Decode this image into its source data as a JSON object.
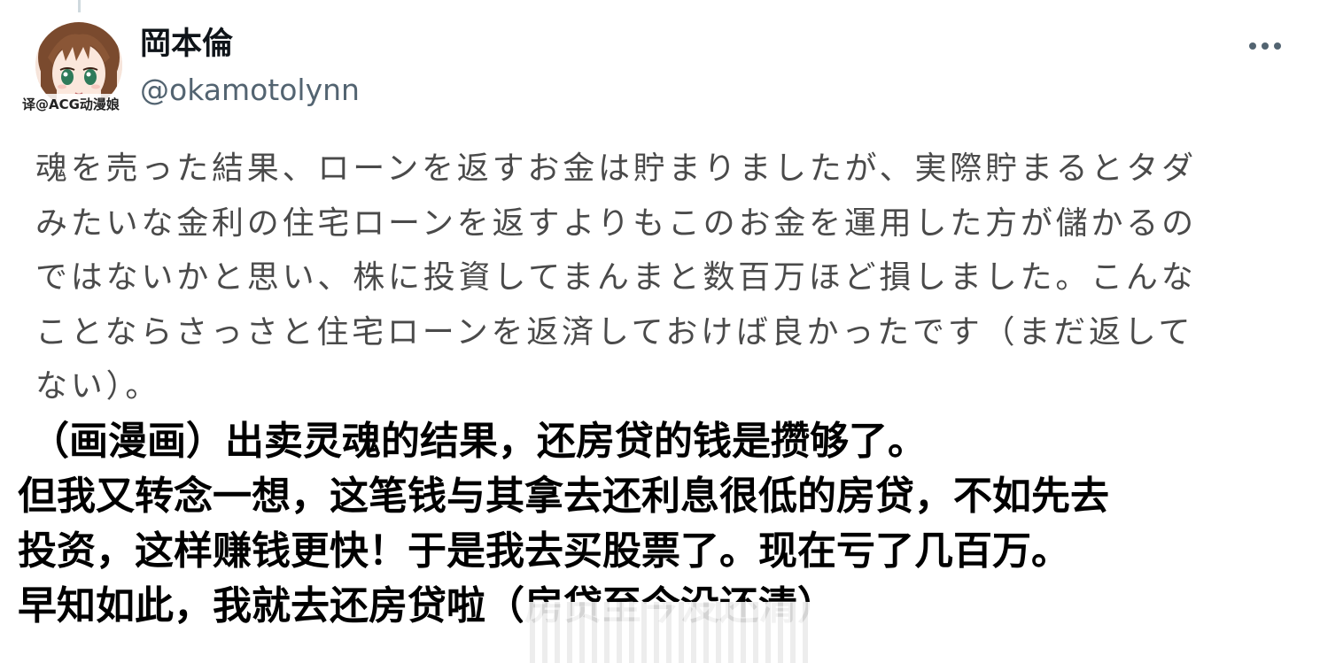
{
  "author": {
    "display_name": "岡本倫",
    "handle": "@okamotolynn",
    "avatar_watermark": "译@ACG动漫娘"
  },
  "tweet": {
    "lines": [
      "魂を売った結果、ローンを返すお金は貯まりましたが、実際貯まるとタダ",
      "みたいな金利の住宅ローンを返すよりもこのお金を運用した方が儲かるの",
      "ではないかと思い、株に投資してまんまと数百万ほど損しました。こんな",
      "ことならさっさと住宅ローンを返済しておけば良かったです（まだ返して",
      "ない）。"
    ]
  },
  "translation": {
    "lines": [
      "（画漫画）出卖灵魂的结果，还房贷的钱是攒够了。",
      "但我又转念一想，这笔钱与其拿去还利息很低的房贷，不如先去",
      "投资，这样赚钱更快！于是我去买股票了。现在亏了几百万。",
      "早知如此，我就去还房贷啦（房贷至今没还清）"
    ]
  },
  "icons": {
    "more": "more-horizontal-icon"
  },
  "colors": {
    "handle": "#536471",
    "tweet_text": "#4a4a4a",
    "translation_text": "#000000",
    "thread_line": "#cfd9de"
  }
}
